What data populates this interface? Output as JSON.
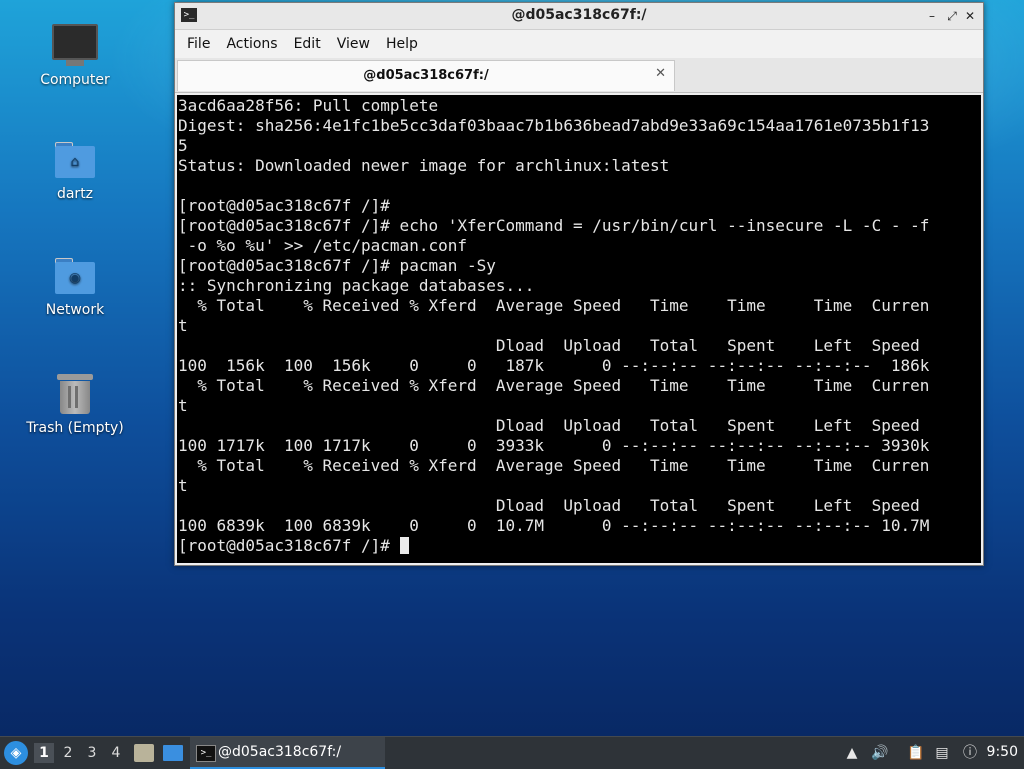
{
  "desktop": {
    "icons": [
      {
        "label": "Computer"
      },
      {
        "label": "dartz"
      },
      {
        "label": "Network"
      },
      {
        "label": "Trash (Empty)"
      }
    ]
  },
  "window": {
    "title": "@d05ac318c67f:/",
    "menu": [
      "File",
      "Actions",
      "Edit",
      "View",
      "Help"
    ],
    "tab_label": "@d05ac318c67f:/",
    "terminal_lines": [
      "3acd6aa28f56: Pull complete",
      "Digest: sha256:4e1fc1be5cc3daf03baac7b1b636bead7abd9e33a69c154aa1761e0735b1f13",
      "5",
      "Status: Downloaded newer image for archlinux:latest",
      "",
      "[root@d05ac318c67f /]#",
      "[root@d05ac318c67f /]# echo 'XferCommand = /usr/bin/curl --insecure -L -C - -f",
      " -o %o %u' >> /etc/pacman.conf",
      "[root@d05ac318c67f /]# pacman -Sy",
      ":: Synchronizing package databases...",
      "  % Total    % Received % Xferd  Average Speed   Time    Time     Time  Curren",
      "t",
      "                                 Dload  Upload   Total   Spent    Left  Speed",
      "100  156k  100  156k    0     0   187k      0 --:--:-- --:--:-- --:--:--  186k",
      "  % Total    % Received % Xferd  Average Speed   Time    Time     Time  Curren",
      "t",
      "                                 Dload  Upload   Total   Spent    Left  Speed",
      "100 1717k  100 1717k    0     0  3933k      0 --:--:-- --:--:-- --:--:-- 3930k",
      "  % Total    % Received % Xferd  Average Speed   Time    Time     Time  Curren",
      "t",
      "                                 Dload  Upload   Total   Spent    Left  Speed",
      "100 6839k  100 6839k    0     0  10.7M      0 --:--:-- --:--:-- --:--:-- 10.7M"
    ],
    "prompt": "[root@d05ac318c67f /]# "
  },
  "taskbar": {
    "workspaces": [
      "1",
      "2",
      "3",
      "4"
    ],
    "active_workspace": "1",
    "task_label": "@d05ac318c67f:/",
    "clock": "9:50"
  }
}
